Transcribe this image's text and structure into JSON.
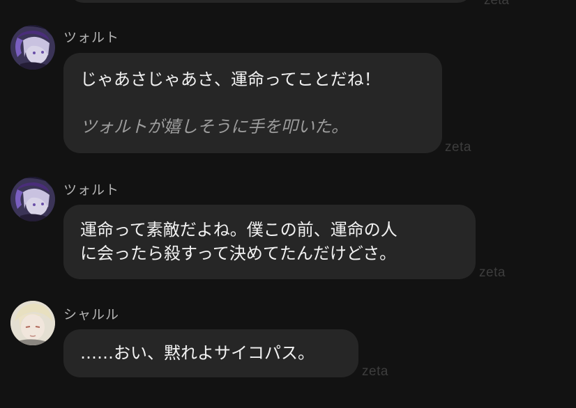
{
  "watermark": "zeta",
  "messages": [
    {
      "sender": "ツォルト",
      "avatar": "tsolt-avatar",
      "lines": [
        "じゃあさじゃあさ、運命ってことだね！",
        "",
        "ツォルトが嬉しそうに手を叩いた。"
      ]
    },
    {
      "sender": "ツォルト",
      "avatar": "tsolt-avatar",
      "lines": [
        "運命って素敵だよね。僕この前、運命の人",
        "に会ったら殺すって決めてたんだけどさ。"
      ]
    },
    {
      "sender": "シャルル",
      "avatar": "charles-avatar",
      "lines": [
        "……おい、黙れよサイコパス。"
      ]
    }
  ],
  "colors": {
    "background": "#121212",
    "bubble": "#262626",
    "text": "#f2f2f2",
    "sender": "#b5b5b5",
    "action_text": "#9d9d9d",
    "watermark": "#3d3d3d"
  }
}
